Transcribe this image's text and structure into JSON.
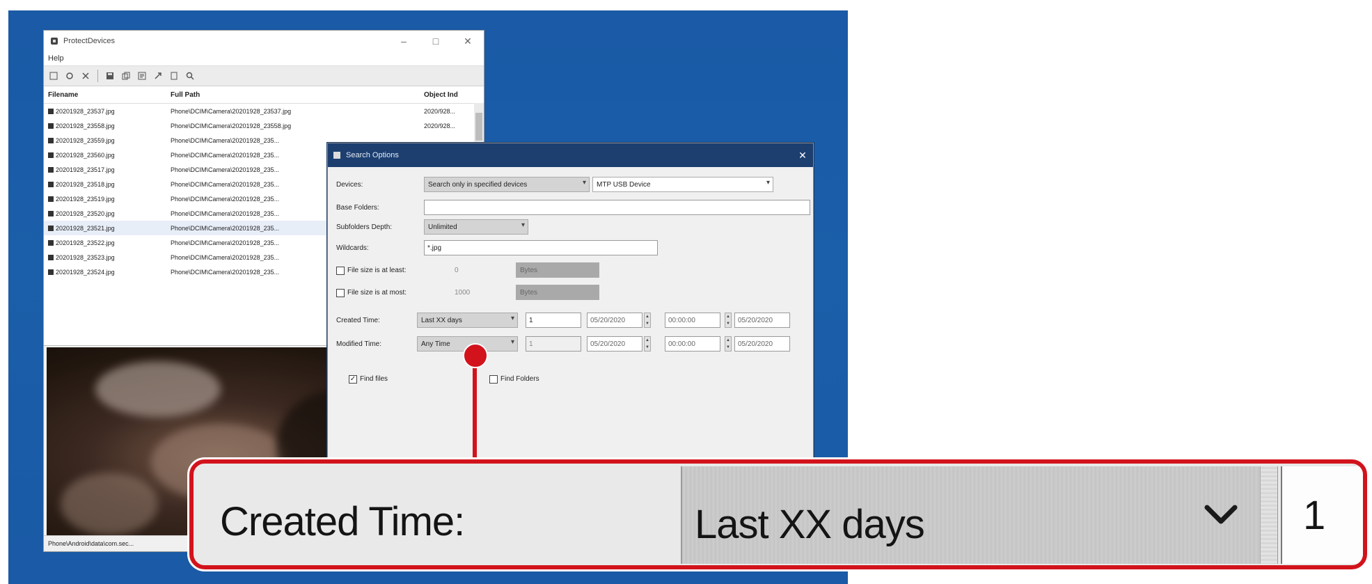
{
  "main_window": {
    "title": "ProtectDevices",
    "menu": [
      "Help"
    ],
    "columns": {
      "filename": "Filename",
      "full_path": "Full Path",
      "object": "Object Ind"
    },
    "rows": [
      {
        "name": "20201928_23537.jpg",
        "path": "Phone\\DCIM\\Camera\\20201928_23537.jpg",
        "obj": "2020/928..."
      },
      {
        "name": "20201928_23558.jpg",
        "path": "Phone\\DCIM\\Camera\\20201928_23558.jpg",
        "obj": "2020/928..."
      },
      {
        "name": "20201928_23559.jpg",
        "path": "Phone\\DCIM\\Camera\\20201928_235...",
        "obj": ""
      },
      {
        "name": "20201928_23560.jpg",
        "path": "Phone\\DCIM\\Camera\\20201928_235...",
        "obj": ""
      },
      {
        "name": "20201928_23517.jpg",
        "path": "Phone\\DCIM\\Camera\\20201928_235...",
        "obj": ""
      },
      {
        "name": "20201928_23518.jpg",
        "path": "Phone\\DCIM\\Camera\\20201928_235...",
        "obj": ""
      },
      {
        "name": "20201928_23519.jpg",
        "path": "Phone\\DCIM\\Camera\\20201928_235...",
        "obj": ""
      },
      {
        "name": "20201928_23520.jpg",
        "path": "Phone\\DCIM\\Camera\\20201928_235...",
        "obj": ""
      },
      {
        "name": "20201928_23521.jpg",
        "path": "Phone\\DCIM\\Camera\\20201928_235...",
        "obj": ""
      },
      {
        "name": "20201928_23522.jpg",
        "path": "Phone\\DCIM\\Camera\\20201928_235...",
        "obj": ""
      },
      {
        "name": "20201928_23523.jpg",
        "path": "Phone\\DCIM\\Camera\\20201928_235...",
        "obj": ""
      },
      {
        "name": "20201928_23524.jpg",
        "path": "Phone\\DCIM\\Camera\\20201928_235...",
        "obj": ""
      }
    ],
    "status": "Phone\\Android\\data\\com.sec..."
  },
  "dialog": {
    "title": "Search Options",
    "device_label": "Devices:",
    "device_mode": "Search only in specified devices",
    "device_select": "MTP USB Device",
    "base_folders_label": "Base Folders:",
    "base_folders_value": "",
    "subfolders_label": "Subfolders Depth:",
    "subfolders_value": "Unlimited",
    "wildcards_label": "Wildcards:",
    "wildcards_value": "*.jpg",
    "file_size_min_label": "File size is at least:",
    "file_size_min_value": "0",
    "file_size_min_unit": "Bytes",
    "file_size_max_label": "File size is at most:",
    "file_size_max_value": "1000",
    "file_size_max_unit": "Bytes",
    "created_label": "Created Time:",
    "created_mode": "Last XX days",
    "created_value": "1",
    "created_date1": "05/20/2020",
    "created_time1": "00:00:00",
    "created_date2": "05/20/2020",
    "modified_label": "Modified Time:",
    "modified_mode": "Any Time",
    "modified_value": "1",
    "modified_date1": "05/20/2020",
    "modified_time1": "00:00:00",
    "modified_date2": "05/20/2020",
    "find_files_label": "Find files",
    "find_folders_label": "Find Folders"
  },
  "zoom": {
    "label": "Created Time:",
    "combo": "Last XX days",
    "value": "1"
  },
  "colors": {
    "desktop": "#1a5aa6",
    "callout": "#d2131c",
    "dialog_title": "#1c3f70"
  }
}
